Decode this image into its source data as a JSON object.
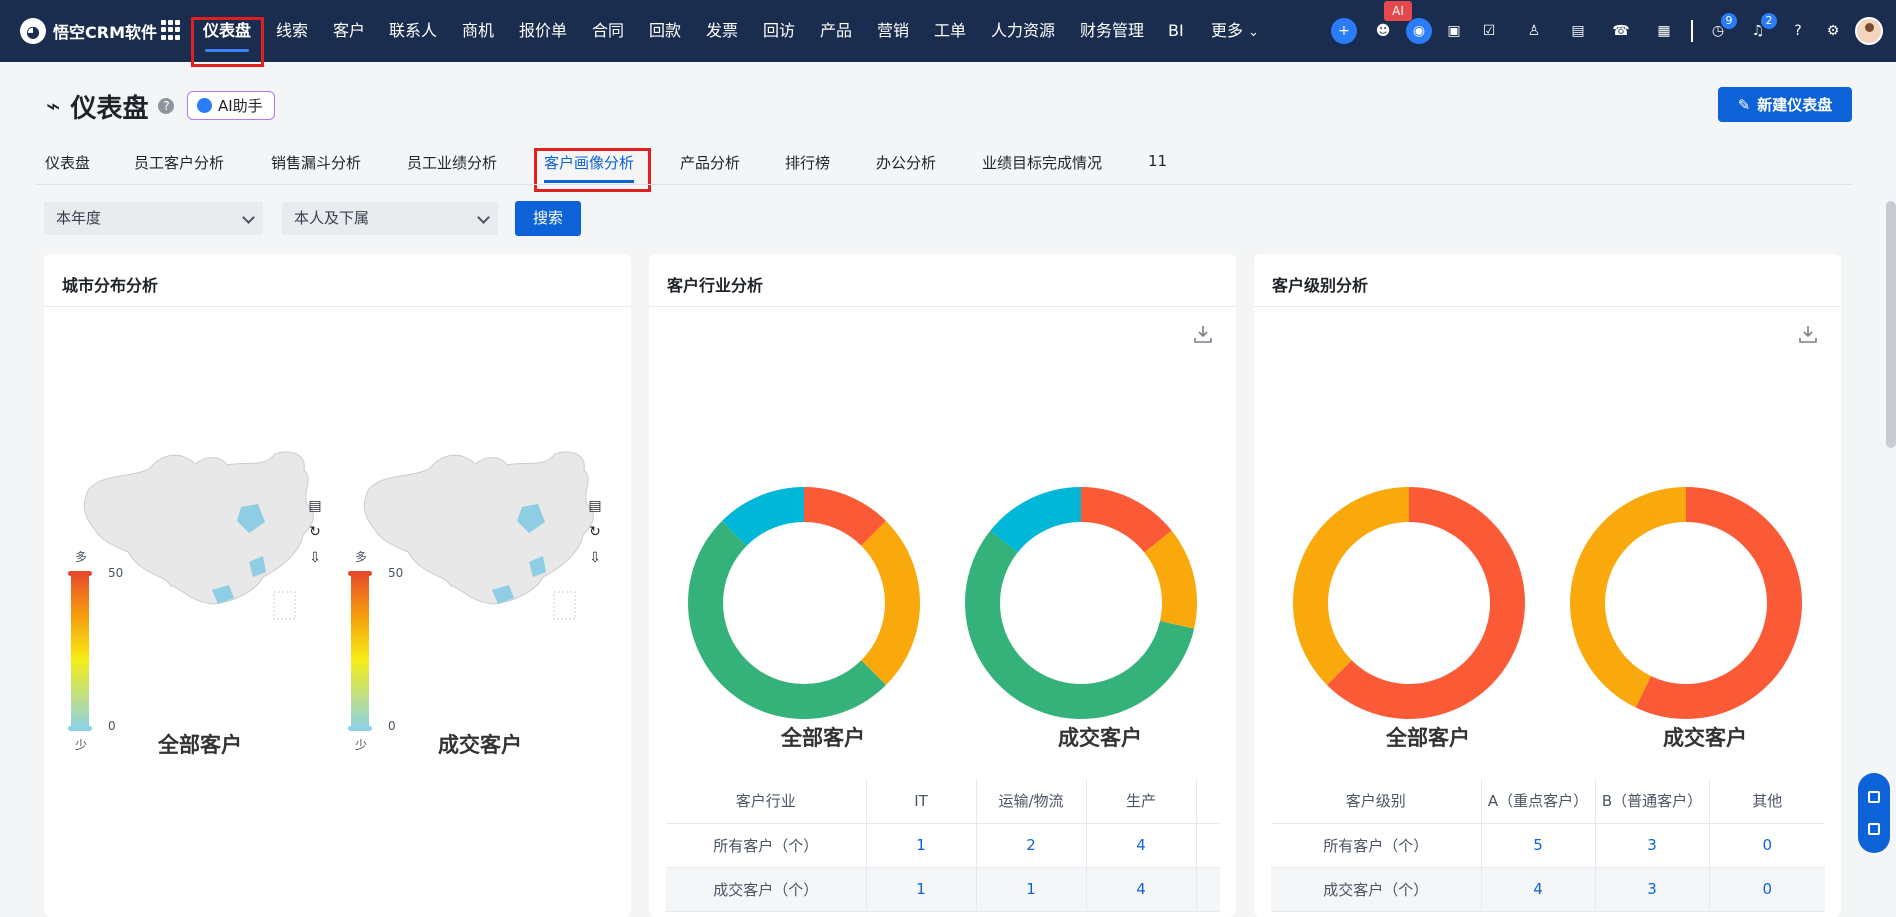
{
  "brand": {
    "name": "悟空CRM软件",
    "logo_icon": "monkey-logo-icon"
  },
  "nav": {
    "items": [
      "仪表盘",
      "线索",
      "客户",
      "联系人",
      "商机",
      "报价单",
      "合同",
      "回款",
      "发票",
      "回访",
      "产品",
      "营销",
      "工单",
      "人力资源",
      "财务管理",
      "BI",
      "更多"
    ],
    "active": "仪表盘"
  },
  "top_icons": {
    "ai_label": "AI",
    "notice_count": "9",
    "bell_count": "2",
    "help": "?"
  },
  "page": {
    "title": "仪表盘",
    "ai_helper": "AI助手",
    "new_button": "新建仪表盘"
  },
  "tabs": [
    "仪表盘",
    "员工客户分析",
    "销售漏斗分析",
    "员工业绩分析",
    "客户画像分析",
    "产品分析",
    "排行榜",
    "办公分析",
    "业绩目标完成情况",
    "11"
  ],
  "active_tab": "客户画像分析",
  "filters": {
    "period": "本年度",
    "scope": "本人及下属",
    "search": "搜索"
  },
  "city_card": {
    "title": "城市分布分析",
    "legend_top": "多",
    "legend_max": "50",
    "legend_min": "0",
    "legend_bottom": "少",
    "maps": [
      "全部客户",
      "成交客户"
    ]
  },
  "industry_card": {
    "title": "客户行业分析",
    "chart_labels": [
      "全部客户",
      "成交客户"
    ],
    "table": {
      "headers": [
        "客户行业",
        "IT",
        "运输/物流",
        "生产"
      ],
      "rows": [
        {
          "label": "所有客户（个）",
          "values": [
            "1",
            "2",
            "4"
          ]
        },
        {
          "label": "成交客户（个）",
          "values": [
            "1",
            "1",
            "4"
          ]
        }
      ]
    }
  },
  "level_card": {
    "title": "客户级别分析",
    "chart_labels": [
      "全部客户",
      "成交客户"
    ],
    "table": {
      "headers": [
        "客户级别",
        "A（重点客户）",
        "B（普通客户）",
        "其他"
      ],
      "rows": [
        {
          "label": "所有客户（个）",
          "values": [
            "5",
            "3",
            "0"
          ]
        },
        {
          "label": "成交客户（个）",
          "values": [
            "4",
            "3",
            "0"
          ]
        }
      ]
    }
  },
  "chart_data": [
    {
      "type": "pie",
      "title": "全部客户",
      "series": [
        {
          "values": [
            1,
            2,
            4,
            1
          ]
        }
      ],
      "colors": [
        "#fb5a36",
        "#f9a90b",
        "#35b27a",
        "#00b7d8"
      ]
    },
    {
      "type": "pie",
      "title": "成交客户",
      "series": [
        {
          "values": [
            1,
            1,
            4,
            1
          ]
        }
      ],
      "colors": [
        "#fb5a36",
        "#f9a90b",
        "#35b27a",
        "#00b7d8"
      ]
    },
    {
      "type": "pie",
      "title": "全部客户",
      "series": [
        {
          "values": [
            5,
            3
          ]
        }
      ],
      "colors": [
        "#fb5a36",
        "#f9a90b"
      ]
    },
    {
      "type": "pie",
      "title": "成交客户",
      "series": [
        {
          "values": [
            4,
            3
          ]
        }
      ],
      "colors": [
        "#fb5a36",
        "#f9a90b"
      ]
    }
  ]
}
